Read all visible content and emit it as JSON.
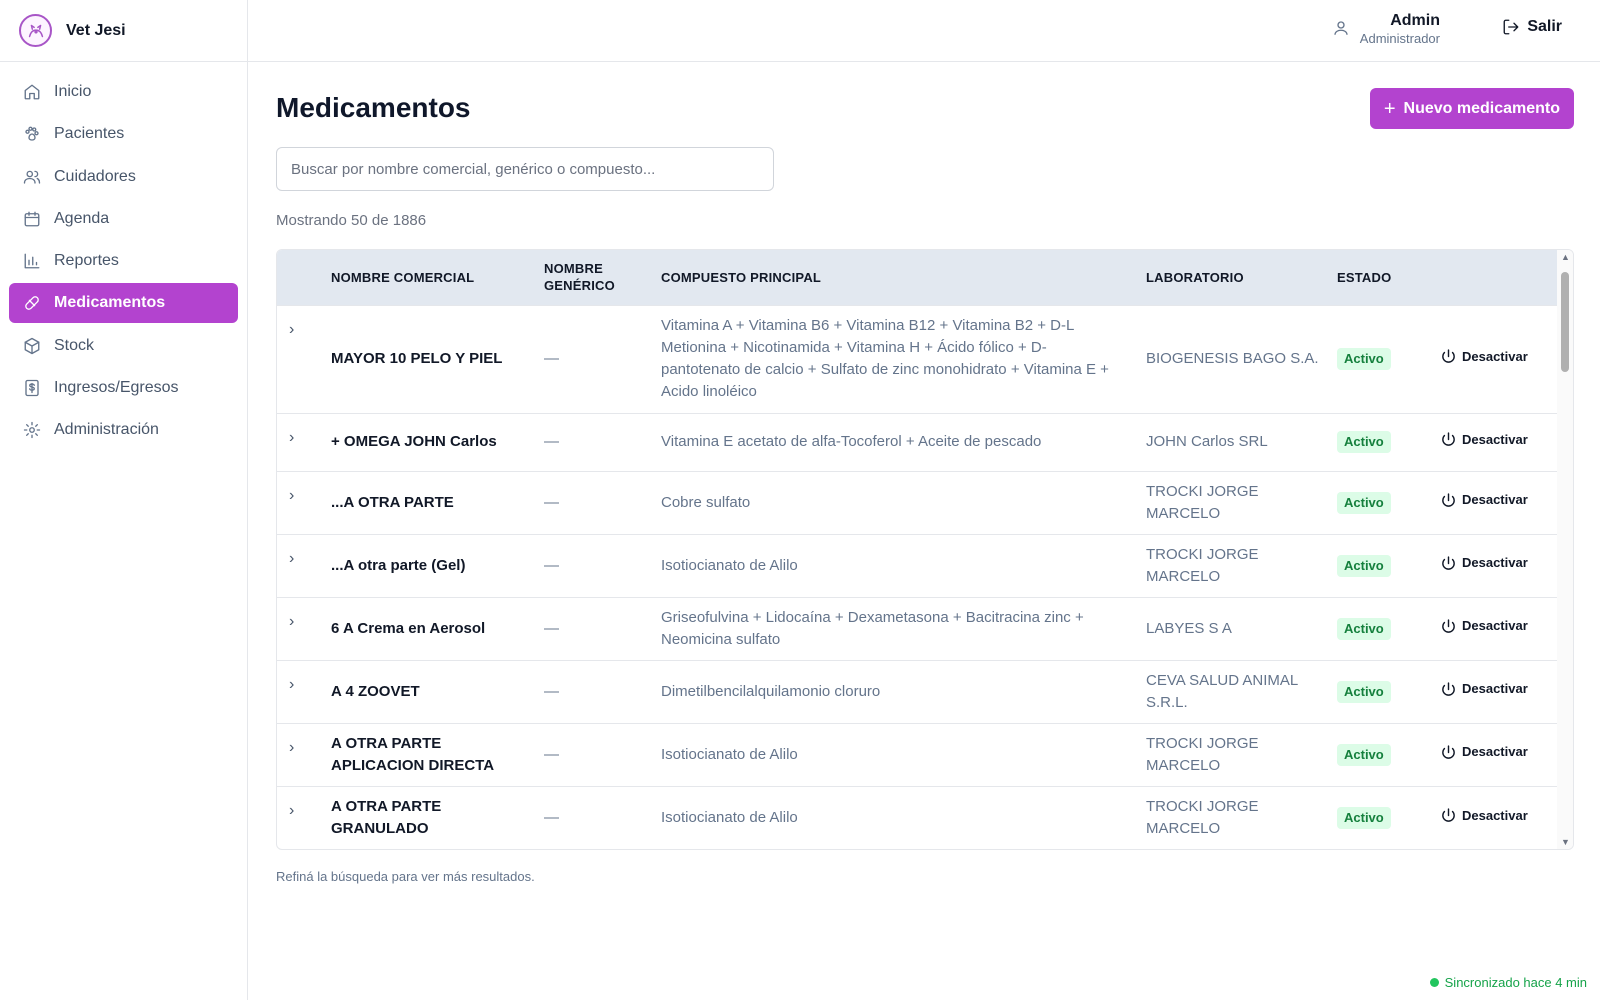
{
  "brand": {
    "name": "Vet Jesi"
  },
  "sidebar": {
    "items": [
      {
        "label": "Inicio",
        "icon": "home-icon"
      },
      {
        "label": "Pacientes",
        "icon": "paw-icon"
      },
      {
        "label": "Cuidadores",
        "icon": "users-icon"
      },
      {
        "label": "Agenda",
        "icon": "calendar-icon"
      },
      {
        "label": "Reportes",
        "icon": "bar-chart-icon"
      },
      {
        "label": "Medicamentos",
        "icon": "pill-icon",
        "active": true
      },
      {
        "label": "Stock",
        "icon": "package-icon"
      },
      {
        "label": "Ingresos/Egresos",
        "icon": "receipt-icon"
      },
      {
        "label": "Administración",
        "icon": "gear-icon"
      }
    ]
  },
  "header": {
    "user_name": "Admin",
    "user_role": "Administrador",
    "logout_label": "Salir"
  },
  "main": {
    "title": "Medicamentos",
    "new_button_label": "Nuevo medicamento",
    "search_placeholder": "Buscar por nombre comercial, genérico o compuesto...",
    "search_value": "",
    "count_text": "Mostrando 50 de 1886",
    "columns": [
      "NOMBRE COMERCIAL",
      "NOMBRE GENÉRICO",
      "COMPUESTO PRINCIPAL",
      "LABORATORIO",
      "ESTADO"
    ],
    "rows": [
      {
        "nombre": "MAYOR 10 PELO Y PIEL",
        "generico": "—",
        "compuesto": "Vitamina A + Vitamina B6 + Vitamina B12 + Vitamina B2 + D-L Metionina + Nicotinamida + Vitamina H + Ácido fólico + D-pantotenato de calcio + Sulfato de zinc monohidrato + Vitamina E + Acido linoléico",
        "laboratorio": "BIOGENESIS BAGO S.A.",
        "estado": "Activo",
        "accion": "Desactivar"
      },
      {
        "nombre": "+ OMEGA JOHN Carlos",
        "generico": "—",
        "compuesto": "Vitamina E acetato de alfa-Tocoferol + Aceite de pescado",
        "laboratorio": "JOHN Carlos SRL",
        "estado": "Activo",
        "accion": "Desactivar"
      },
      {
        "nombre": "...A OTRA PARTE",
        "generico": "—",
        "compuesto": "Cobre sulfato",
        "laboratorio": "TROCKI JORGE MARCELO",
        "estado": "Activo",
        "accion": "Desactivar"
      },
      {
        "nombre": "...A otra parte (Gel)",
        "generico": "—",
        "compuesto": "Isotiocianato de Alilo",
        "laboratorio": "TROCKI JORGE MARCELO",
        "estado": "Activo",
        "accion": "Desactivar"
      },
      {
        "nombre": "6 A Crema en Aerosol",
        "generico": "—",
        "compuesto": "Griseofulvina + Lidocaína + Dexametasona + Bacitracina zinc + Neomicina sulfato",
        "laboratorio": "LABYES S A",
        "estado": "Activo",
        "accion": "Desactivar"
      },
      {
        "nombre": "A 4 ZOOVET",
        "generico": "—",
        "compuesto": "Dimetilbencilalquilamonio cloruro",
        "laboratorio": "CEVA SALUD ANIMAL S.R.L.",
        "estado": "Activo",
        "accion": "Desactivar"
      },
      {
        "nombre": "A OTRA PARTE APLICACION DIRECTA",
        "generico": "—",
        "compuesto": "Isotiocianato de Alilo",
        "laboratorio": "TROCKI JORGE MARCELO",
        "estado": "Activo",
        "accion": "Desactivar"
      },
      {
        "nombre": "A OTRA PARTE GRANULADO",
        "generico": "—",
        "compuesto": "Isotiocianato de Alilo",
        "laboratorio": "TROCKI JORGE MARCELO",
        "estado": "Activo",
        "accion": "Desactivar"
      }
    ],
    "hint": "Refiná la búsqueda para ver más resultados."
  },
  "status": {
    "sync_text": "Sincronizado hace 4 min"
  },
  "colors": {
    "accent": "#b343cf",
    "active_badge_bg": "#dcfce7",
    "active_badge_text": "#15803d",
    "sync": "#16a34a"
  }
}
